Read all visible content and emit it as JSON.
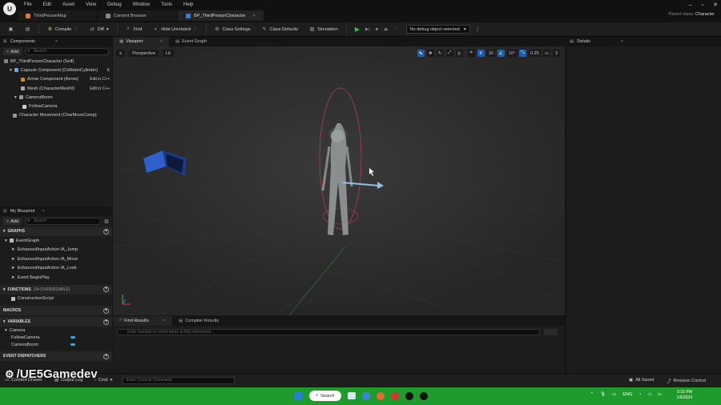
{
  "menu": [
    "File",
    "Edit",
    "Asset",
    "View",
    "Debug",
    "Window",
    "Tools",
    "Help"
  ],
  "tabs": [
    {
      "label": "ThirdPersonMap",
      "active": false
    },
    {
      "label": "Content Browser",
      "active": false
    },
    {
      "label": "BP_ThirdPersonCharacter",
      "active": true
    }
  ],
  "parent_class": {
    "label": "Parent class:",
    "value": "Character"
  },
  "toolbar": {
    "compile": "Compile",
    "diff": "Diff",
    "find": "Find",
    "hide_unrelated": "Hide Unrelated",
    "class_settings": "Class Settings",
    "class_defaults": "Class Defaults",
    "simulation": "Simulation",
    "debug_select": "No debug object selected"
  },
  "components": {
    "title": "Components",
    "add": "Add",
    "search_placeholder": "Search",
    "items": [
      {
        "label": "BP_ThirdPersonCharacter (Self)",
        "edit": ""
      },
      {
        "label": "Capsule Component (CollisionCylinder)",
        "edit": "E"
      },
      {
        "label": "Arrow Component (Arrow)",
        "edit": "Edit in C++"
      },
      {
        "label": "Mesh (CharacterMesh0)",
        "edit": "Edit in C++"
      },
      {
        "label": "CameraBoom",
        "edit": ""
      },
      {
        "label": "FollowCamera",
        "edit": ""
      },
      {
        "label": "Character Movement (CharMoveComp)",
        "edit": ""
      }
    ]
  },
  "my_blueprint": {
    "title": "My Blueprint",
    "add": "Add",
    "search_placeholder": "Search",
    "graphs_label": "GRAPHS",
    "event_graph": "EventGraph",
    "events": [
      "EnhancedInputAction IA_Jump",
      "EnhancedInputAction IA_Move",
      "EnhancedInputAction IA_Look",
      "Event BeginPlay"
    ],
    "functions_label": "FUNCTIONS",
    "functions_count": "(34 OVERRIDABLE)",
    "functions": [
      "ConstructionScript"
    ],
    "macros_label": "MACROS",
    "variables_label": "VARIABLES",
    "var_category": "Camera",
    "variables": [
      "FollowCamera",
      "CameraBoom"
    ],
    "dispatchers_label": "EVENT DISPATCHERS"
  },
  "viewport": {
    "tab_viewport": "Viewport",
    "tab_event_graph": "Event Graph",
    "perspective": "Perspective",
    "lit": "Lit",
    "grid": "10",
    "rot": "10°",
    "scale": "0.25",
    "cam": "3"
  },
  "details": {
    "title": "Details"
  },
  "bottom": {
    "find_results": "Find Results",
    "compiler_results": "Compiler Results",
    "search_placeholder": "Enter function or event name to find references..."
  },
  "status": {
    "content_drawer": "Content Drawer",
    "output_log": "Output Log",
    "cmd": "Cmd",
    "console_placeholder": "Enter Console Command",
    "all_saved": "All Saved",
    "revision": "Revision Control"
  },
  "watermark": "/UE5Gamedev",
  "taskbar": {
    "search": "Search",
    "lang": "ENG",
    "time": "5:22 PM",
    "date": "1/6/2024"
  }
}
